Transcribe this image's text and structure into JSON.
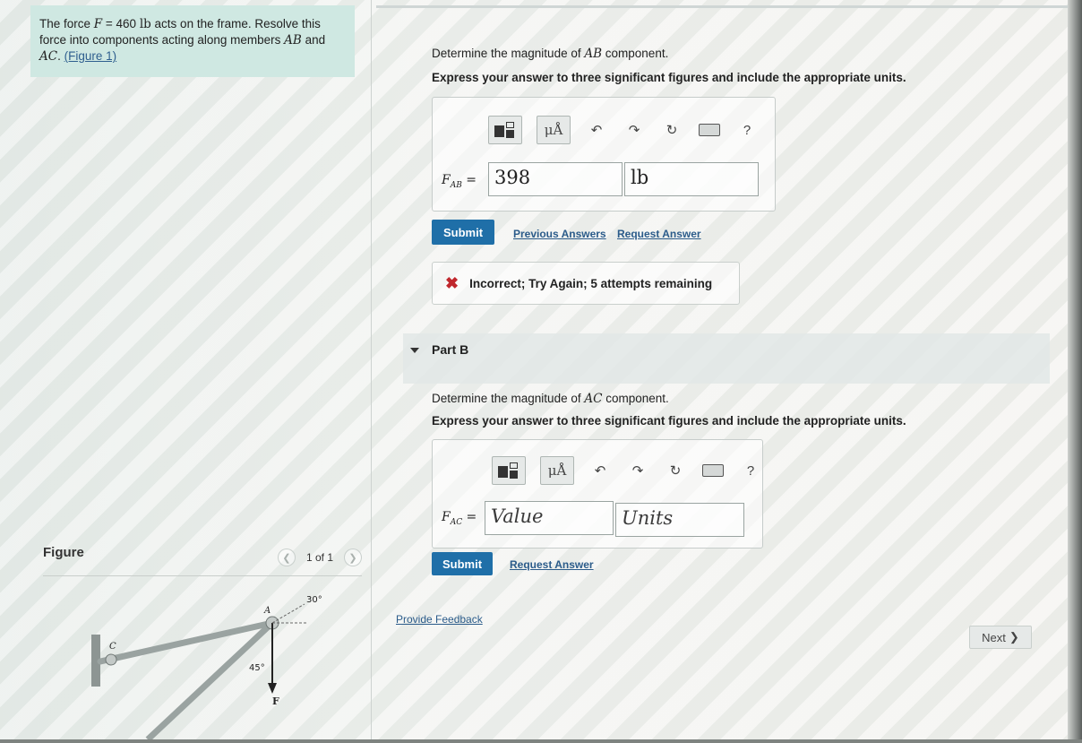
{
  "problem": {
    "text_1": "The force ",
    "force_var": "F",
    "equals": " = 460 ",
    "unit": "lb",
    "text_2": " acts on the frame. Resolve this force into components acting along members ",
    "member_ab": "AB",
    "and": " and ",
    "member_ac": "AC",
    "period": ". ",
    "figure_link": "(Figure 1)"
  },
  "figure": {
    "heading": "Figure",
    "pager": "1 of 1",
    "prev_icon": "chevron-left-icon",
    "next_icon": "chevron-right-icon",
    "labels": {
      "a": "A",
      "c": "C",
      "f": "F",
      "angle_30": "30°",
      "angle_45": "45°"
    }
  },
  "part_a": {
    "question_pre": "Determine the magnitude of ",
    "question_var": "AB",
    "question_post": " component.",
    "instruction": "Express your answer to three significant figures and include the appropriate units.",
    "toolbar": {
      "help": "?",
      "units_label": "μÅ"
    },
    "var_main": "F",
    "var_sub": "AB",
    "var_eq": " =",
    "value": "398",
    "units": "lb",
    "submit": "Submit",
    "previous_answers": "Previous Answers",
    "request_answer": "Request Answer",
    "feedback": "Incorrect; Try Again; 5 attempts remaining"
  },
  "part_b": {
    "title": "Part B",
    "question_pre": "Determine the magnitude of ",
    "question_var": "AC",
    "question_post": " component.",
    "instruction": "Express your answer to three significant figures and include the appropriate units.",
    "toolbar": {
      "help": "?",
      "units_label": "μÅ"
    },
    "var_main": "F",
    "var_sub": "AC",
    "var_eq": " =",
    "value_placeholder": "Value",
    "units_placeholder": "Units",
    "submit": "Submit",
    "request_answer": "Request Answer"
  },
  "footer": {
    "provide_feedback": "Provide Feedback",
    "next": "Next",
    "next_icon": "chevron-right-icon"
  },
  "colors": {
    "problem_bg": "#cfe8e2",
    "submit_bg": "#1f6fa8",
    "link": "#2b5b8a",
    "error": "#c0272d"
  }
}
